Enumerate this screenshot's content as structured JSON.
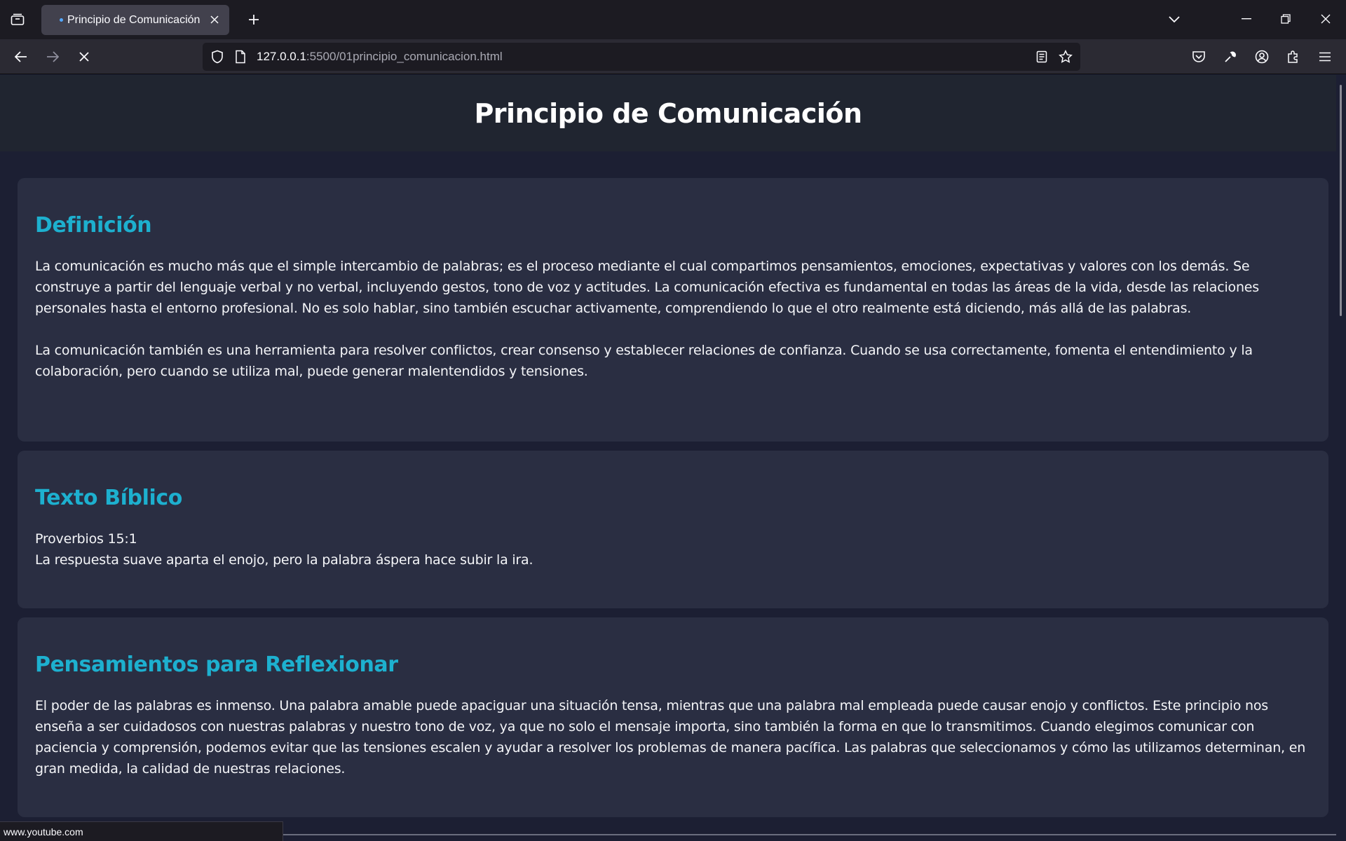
{
  "browser": {
    "tab_title": "Principio de Comunicación",
    "url_host": "127.0.0.1",
    "url_rest": ":5500/01principio_comunicacion.html",
    "status_url": "www.youtube.com"
  },
  "page": {
    "title": "Principio de Comunicación",
    "sections": [
      {
        "heading": "Definición",
        "paragraphs": [
          "La comunicación es mucho más que el simple intercambio de palabras; es el proceso mediante el cual compartimos pensamientos, emociones, expectativas y valores con los demás. Se construye a partir del lenguaje verbal y no verbal, incluyendo gestos, tono de voz y actitudes. La comunicación efectiva es fundamental en todas las áreas de la vida, desde las relaciones personales hasta el entorno profesional. No es solo hablar, sino también escuchar activamente, comprendiendo lo que el otro realmente está diciendo, más allá de las palabras.",
          "La comunicación también es una herramienta para resolver conflictos, crear consenso y establecer relaciones de confianza. Cuando se usa correctamente, fomenta el entendimiento y la colaboración, pero cuando se utiliza mal, puede generar malentendidos y tensiones."
        ]
      },
      {
        "heading": "Texto Bíblico",
        "reference": "Proverbios 15:1",
        "verse": "La respuesta suave aparta el enojo, pero la palabra áspera hace subir la ira."
      },
      {
        "heading": "Pensamientos para Reflexionar",
        "paragraphs": [
          "El poder de las palabras es inmenso. Una palabra amable puede apaciguar una situación tensa, mientras que una palabra mal empleada puede causar enojo y conflictos. Este principio nos enseña a ser cuidadosos con nuestras palabras y nuestro tono de voz, ya que no solo el mensaje importa, sino también la forma en que lo transmitimos. Cuando elegimos comunicar con paciencia y comprensión, podemos evitar que las tensiones escalen y ayudar a resolver los problemas de manera pacífica. Las palabras que seleccionamos y cómo las utilizamos determinan, en gran medida, la calidad de nuestras relaciones."
        ]
      }
    ]
  },
  "colors": {
    "page_bg": "#1c1f33",
    "header_bg": "#202530",
    "card_bg": "#2a2e42",
    "heading_accent": "#1db0cf",
    "chrome_bg": "#1c1b22",
    "toolbar_bg": "#2b2a33"
  }
}
